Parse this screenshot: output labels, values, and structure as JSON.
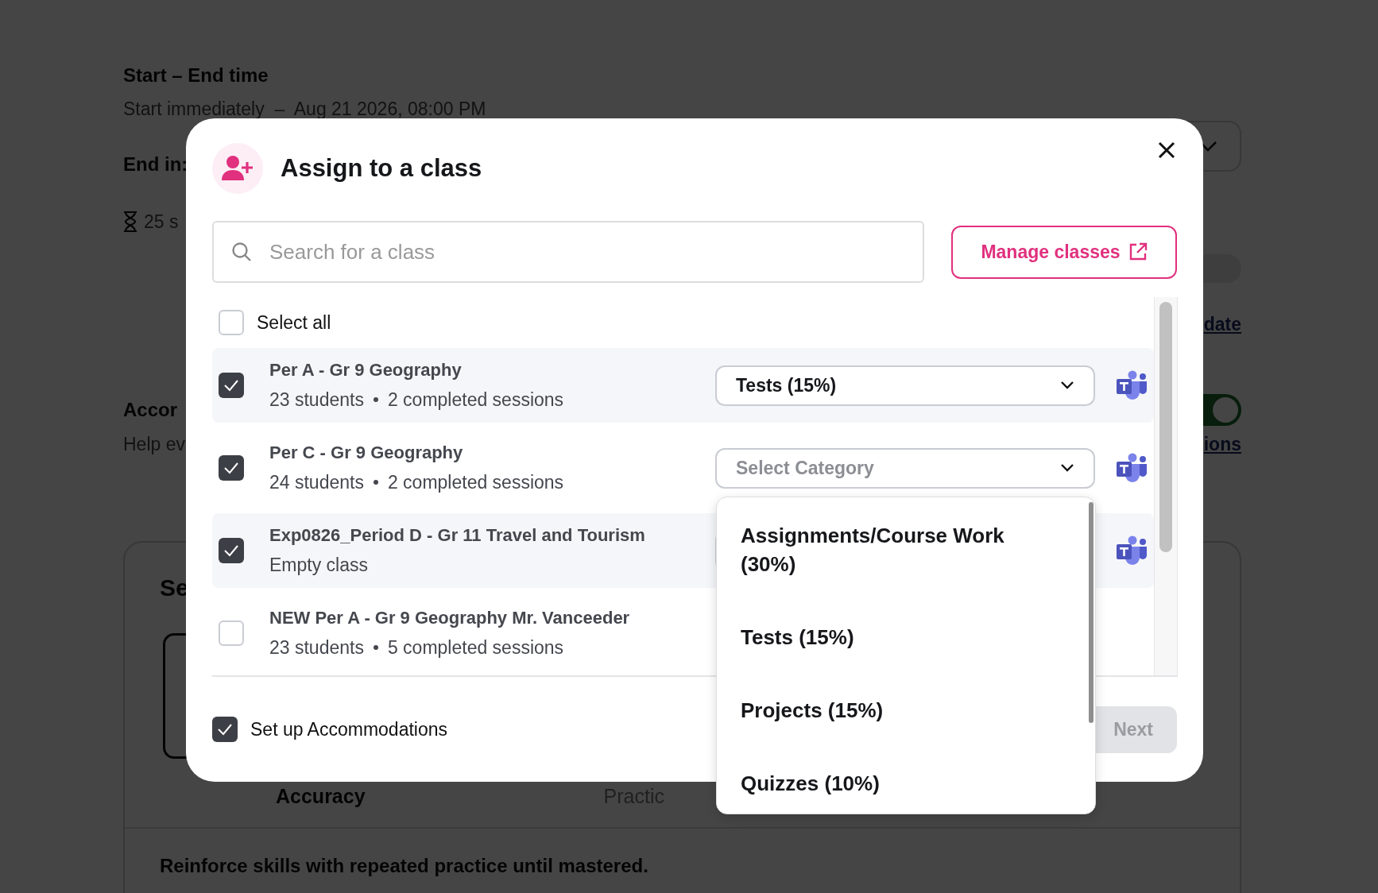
{
  "background": {
    "heading": "Start – End time",
    "schedule": "Start immediately  –  Aug 21 2026, 08:00 PM",
    "end_label": "End in:",
    "duration": "25 s",
    "link_1": "date",
    "section_title": "Accor",
    "section_text": "Help ev",
    "toggle_on": true,
    "link_2": "ions",
    "card_title": "Se",
    "tabs": [
      {
        "label": "Accuracy",
        "selected": true
      },
      {
        "label": "Practic",
        "selected": false
      }
    ],
    "tab_text": "Reinforce skills with repeated practice until mastered."
  },
  "dialog": {
    "title": "Assign to a class",
    "search": {
      "placeholder": "Search for a class"
    },
    "manage_button": "Manage classes",
    "select_all": {
      "label": "Select all",
      "checked": false
    },
    "classes": [
      {
        "name": "Per A - Gr 9 Geography",
        "details": [
          "23 students",
          "2 completed sessions"
        ],
        "checked": true,
        "teams": true,
        "dropdown": {
          "value": "Tests (15%)"
        }
      },
      {
        "name": "Per C - Gr 9 Geography",
        "details": [
          "24 students",
          "2 completed sessions"
        ],
        "checked": true,
        "teams": true,
        "dropdown": {
          "placeholder": "Select Category",
          "options": [
            "Assignments/Course Work (30%)",
            "Tests (15%)",
            "Projects (15%)",
            "Quizzes (10%)"
          ]
        }
      },
      {
        "name": "Exp0826_Period D - Gr 11 Travel and Tourism",
        "details": [
          "Empty class"
        ],
        "checked": true,
        "teams": true,
        "has_dropdown": true
      },
      {
        "name": "NEW Per A - Gr 9 Geography Mr. Vanceeder",
        "details": [
          "23 students",
          "5 completed sessions"
        ],
        "checked": false,
        "teams": false
      }
    ],
    "accommodations": {
      "label": "Set up Accommodations",
      "checked": true
    },
    "next_button": {
      "label": "Next",
      "disabled": true
    }
  }
}
